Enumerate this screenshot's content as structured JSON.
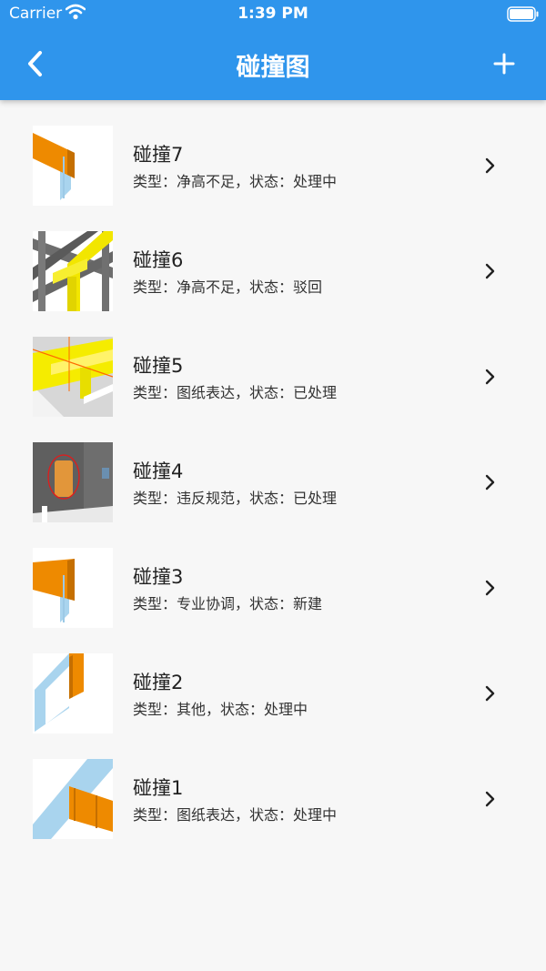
{
  "status": {
    "carrier": "Carrier",
    "time": "1:39 PM"
  },
  "nav": {
    "title": "碰撞图",
    "back_icon": "chevron-left-icon",
    "add_icon": "plus-icon"
  },
  "colors": {
    "header": "#2f95ec",
    "background": "#f7f7f7",
    "orange": "#f08c00",
    "yellow": "#f2e600"
  },
  "items": [
    {
      "title": "碰撞7",
      "subtitle": "类型：净高不足，状态：处理中"
    },
    {
      "title": "碰撞6",
      "subtitle": "类型：净高不足，状态：驳回"
    },
    {
      "title": "碰撞5",
      "subtitle": "类型：图纸表达，状态：已处理"
    },
    {
      "title": "碰撞4",
      "subtitle": "类型：违反规范，状态：已处理"
    },
    {
      "title": "碰撞3",
      "subtitle": "类型：专业协调，状态：新建"
    },
    {
      "title": "碰撞2",
      "subtitle": "类型：其他，状态：处理中"
    },
    {
      "title": "碰撞1",
      "subtitle": "类型：图纸表达，状态：处理中"
    }
  ]
}
